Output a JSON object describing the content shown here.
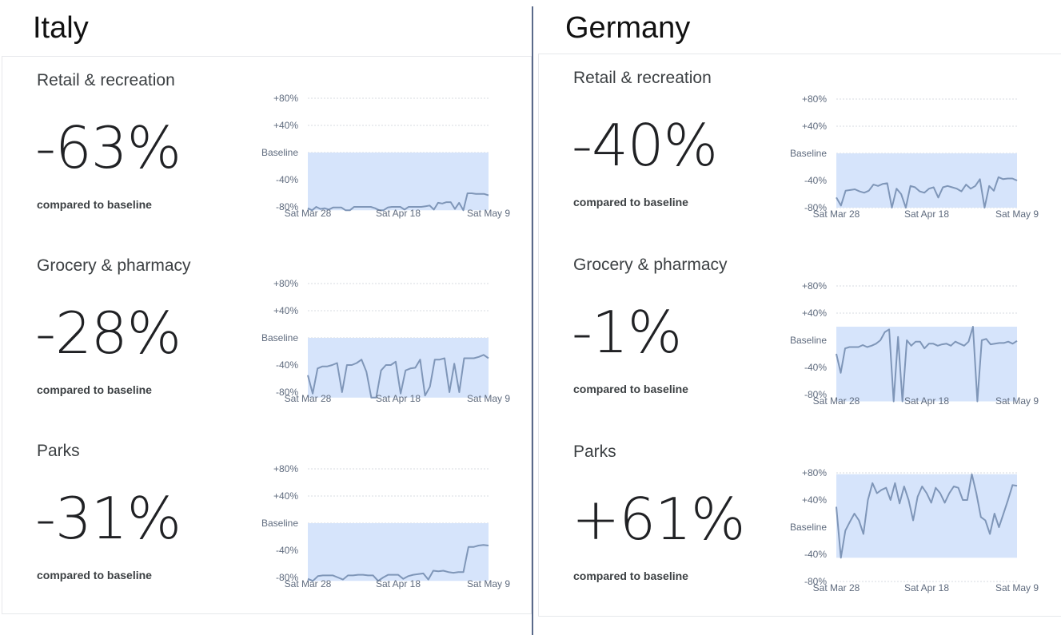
{
  "countries": [
    {
      "name": "Italy",
      "metrics": [
        {
          "label": "Retail & recreation",
          "value": "-63%",
          "compare": "compared to baseline"
        },
        {
          "label": "Grocery & pharmacy",
          "value": "-28%",
          "compare": "compared to baseline"
        },
        {
          "label": "Parks",
          "value": "-31%",
          "compare": "compared to baseline"
        }
      ]
    },
    {
      "name": "Germany",
      "metrics": [
        {
          "label": "Retail & recreation",
          "value": "-40%",
          "compare": "compared to baseline"
        },
        {
          "label": "Grocery & pharmacy",
          "value": "-1%",
          "compare": "compared to baseline"
        },
        {
          "label": "Parks",
          "value": "+61%",
          "compare": "compared to baseline"
        }
      ]
    }
  ],
  "colors": {
    "line": "#7f96b8",
    "fill": "#d6e4fb",
    "grid": "#d7dbe2",
    "axis_text": "#5f6b7e"
  },
  "chart_data": [
    {
      "type": "line",
      "title": "Italy - Retail & recreation",
      "x_range": [
        "Sat Mar 28",
        "Sat May 9"
      ],
      "x_ticks": [
        "Sat Mar 28",
        "Sat Apr 18",
        "Sat May 9"
      ],
      "y_ticks": [
        "+80%",
        "+40%",
        "Baseline",
        "-40%",
        "-80%"
      ],
      "ylim": [
        -80,
        80
      ],
      "grid": true,
      "values": [
        -82,
        -85,
        -80,
        -83,
        -82,
        -84,
        -81,
        -81,
        -81,
        -85,
        -85,
        -80,
        -80,
        -80,
        -80,
        -80,
        -82,
        -85,
        -85,
        -81,
        -80,
        -80,
        -80,
        -84,
        -80,
        -80,
        -80,
        -80,
        -79,
        -78,
        -84,
        -74,
        -75,
        -73,
        -73,
        -83,
        -74,
        -85,
        -60,
        -60,
        -61,
        -61,
        -61,
        -63
      ]
    },
    {
      "type": "line",
      "title": "Italy - Grocery & pharmacy",
      "x_range": [
        "Sat Mar 28",
        "Sat May 9"
      ],
      "x_ticks": [
        "Sat Mar 28",
        "Sat Apr 18",
        "Sat May 9"
      ],
      "y_ticks": [
        "+80%",
        "+40%",
        "Baseline",
        "-40%",
        "-80%"
      ],
      "ylim": [
        -80,
        80
      ],
      "grid": true,
      "values": [
        -55,
        -82,
        -45,
        -42,
        -42,
        -40,
        -37,
        -80,
        -40,
        -40,
        -37,
        -32,
        -50,
        -88,
        -88,
        -48,
        -40,
        -40,
        -35,
        -82,
        -48,
        -45,
        -44,
        -32,
        -85,
        -72,
        -32,
        -32,
        -30,
        -80,
        -38,
        -80,
        -30,
        -30,
        -30,
        -28,
        -25,
        -30
      ]
    },
    {
      "type": "line",
      "title": "Italy - Parks",
      "x_range": [
        "Sat Mar 28",
        "Sat May 9"
      ],
      "x_ticks": [
        "Sat Mar 28",
        "Sat Apr 18",
        "Sat May 9"
      ],
      "y_ticks": [
        "+80%",
        "+40%",
        "Baseline",
        "-40%",
        "-80%"
      ],
      "ylim": [
        -80,
        80
      ],
      "grid": true,
      "values": [
        -82,
        -85,
        -78,
        -77,
        -77,
        -77,
        -80,
        -83,
        -77,
        -77,
        -76,
        -76,
        -77,
        -77,
        -85,
        -80,
        -76,
        -76,
        -76,
        -82,
        -78,
        -76,
        -75,
        -74,
        -83,
        -70,
        -71,
        -70,
        -72,
        -73,
        -72,
        -72,
        -35,
        -35,
        -33,
        -32,
        -33
      ]
    },
    {
      "type": "line",
      "title": "Germany - Retail & recreation",
      "x_range": [
        "Sat Mar 28",
        "Sat May 9"
      ],
      "x_ticks": [
        "Sat Mar 28",
        "Sat Apr 18",
        "Sat May 9"
      ],
      "y_ticks": [
        "+80%",
        "+40%",
        "Baseline",
        "-40%",
        "-80%"
      ],
      "ylim": [
        -80,
        80
      ],
      "grid": true,
      "values": [
        -65,
        -77,
        -55,
        -54,
        -53,
        -56,
        -58,
        -55,
        -46,
        -48,
        -45,
        -44,
        -80,
        -52,
        -60,
        -80,
        -48,
        -50,
        -56,
        -58,
        -52,
        -50,
        -65,
        -50,
        -48,
        -50,
        -52,
        -56,
        -46,
        -52,
        -48,
        -38,
        -80,
        -48,
        -55,
        -35,
        -38,
        -37,
        -37,
        -40
      ]
    },
    {
      "type": "line",
      "title": "Germany - Grocery & pharmacy",
      "x_range": [
        "Sat Mar 28",
        "Sat May 9"
      ],
      "x_ticks": [
        "Sat Mar 28",
        "Sat Apr 18",
        "Sat May 9"
      ],
      "y_ticks": [
        "+80%",
        "+40%",
        "Baseline",
        "-40%",
        "-80%"
      ],
      "ylim": [
        -80,
        80
      ],
      "grid": true,
      "values": [
        -20,
        -48,
        -12,
        -10,
        -10,
        -10,
        -7,
        -10,
        -8,
        -5,
        0,
        12,
        16,
        -90,
        5,
        -90,
        0,
        -8,
        -2,
        -2,
        -12,
        -5,
        -5,
        -8,
        -6,
        -5,
        -8,
        -2,
        -5,
        -8,
        -2,
        20,
        -90,
        0,
        2,
        -6,
        -5,
        -4,
        -4,
        -2,
        -5,
        -1
      ]
    },
    {
      "type": "line",
      "title": "Germany - Parks",
      "x_range": [
        "Sat Mar 28",
        "Sat May 9"
      ],
      "x_ticks": [
        "Sat Mar 28",
        "Sat Apr 18",
        "Sat May 9"
      ],
      "y_ticks": [
        "+80%",
        "+40%",
        "Baseline",
        "-40%",
        "-80%"
      ],
      "ylim": [
        -80,
        80
      ],
      "grid": true,
      "values": [
        30,
        -45,
        -5,
        8,
        20,
        10,
        -10,
        40,
        65,
        50,
        55,
        58,
        40,
        65,
        35,
        60,
        40,
        10,
        45,
        60,
        50,
        36,
        58,
        50,
        36,
        50,
        60,
        58,
        40,
        40,
        78,
        50,
        15,
        10,
        -10,
        20,
        0,
        20,
        40,
        62,
        61
      ]
    }
  ]
}
